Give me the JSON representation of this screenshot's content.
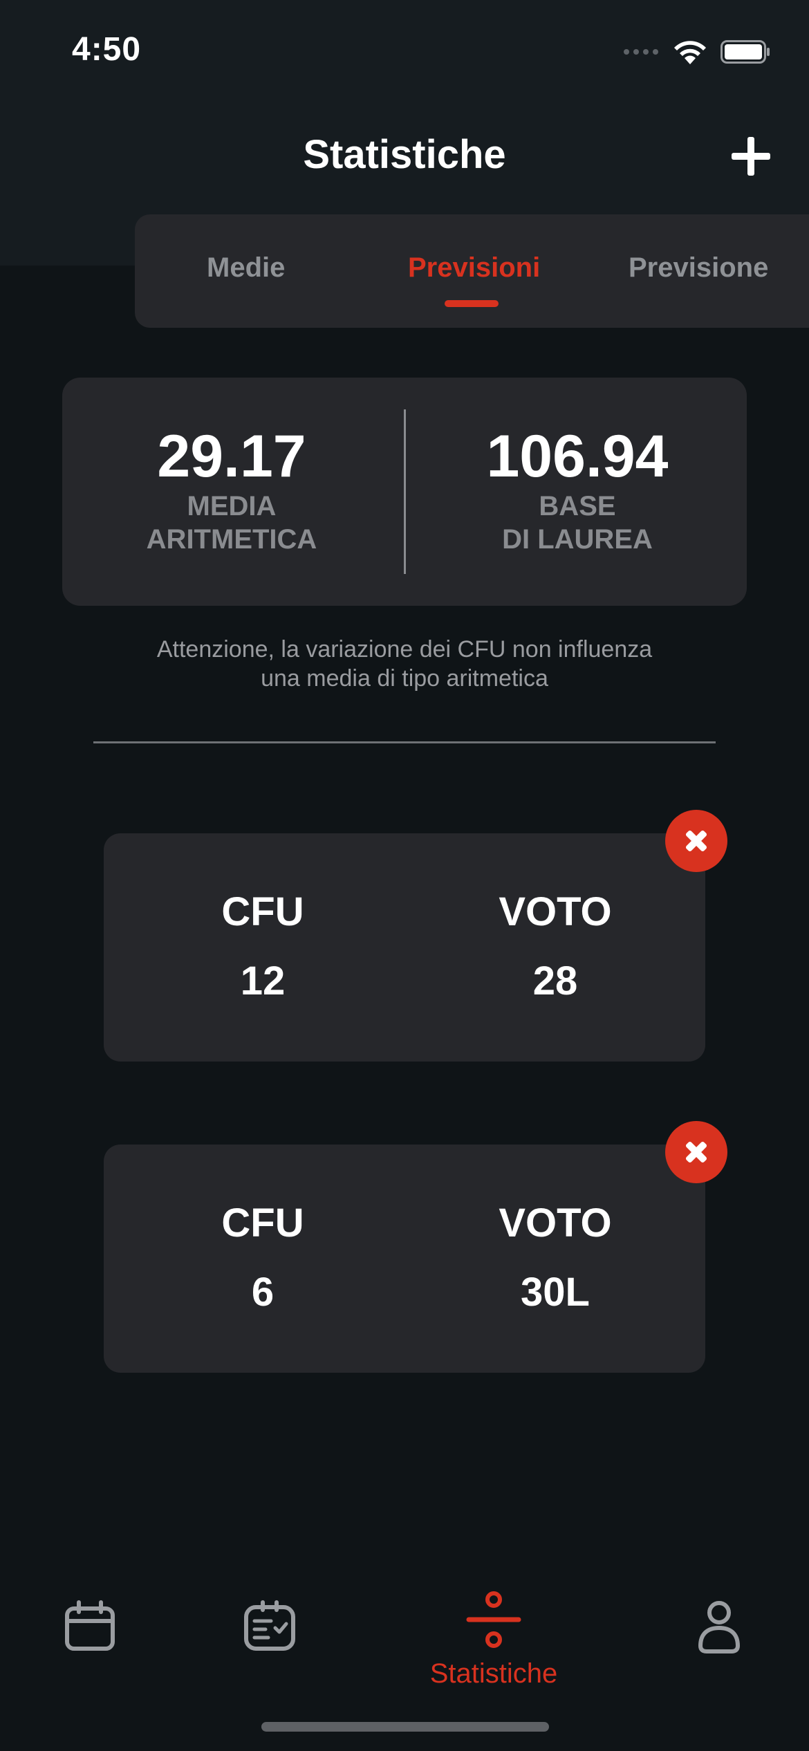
{
  "status_bar": {
    "time": "4:50"
  },
  "header": {
    "title": "Statistiche"
  },
  "tabs": [
    {
      "label": "Medie",
      "active": false
    },
    {
      "label": "Previsioni",
      "active": true
    },
    {
      "label": "Previsione",
      "active": false
    }
  ],
  "summary": {
    "average": {
      "value": "29.17",
      "label_line1": "MEDIA",
      "label_line2": "ARITMETICA"
    },
    "base": {
      "value": "106.94",
      "label_line1": "BASE",
      "label_line2": "DI LAUREA"
    }
  },
  "notice": {
    "line1": "Attenzione, la variazione dei CFU non influenza",
    "line2": "una media di tipo aritmetica"
  },
  "forecasts": [
    {
      "cfu_label": "CFU",
      "cfu": "12",
      "voto_label": "VOTO",
      "voto": "28"
    },
    {
      "cfu_label": "CFU",
      "cfu": "6",
      "voto_label": "VOTO",
      "voto": "30L"
    }
  ],
  "tab_bar": {
    "items": [
      {
        "icon": "calendar-icon",
        "label": ""
      },
      {
        "icon": "exam-list-icon",
        "label": ""
      },
      {
        "icon": "divide-icon",
        "label": "Statistiche",
        "active": true
      },
      {
        "icon": "profile-icon",
        "label": ""
      }
    ]
  },
  "colors": {
    "accent": "#d8321f",
    "background": "#0f1417",
    "header_background": "#161c20",
    "card": "#26272b",
    "muted_text": "#8f9296"
  }
}
